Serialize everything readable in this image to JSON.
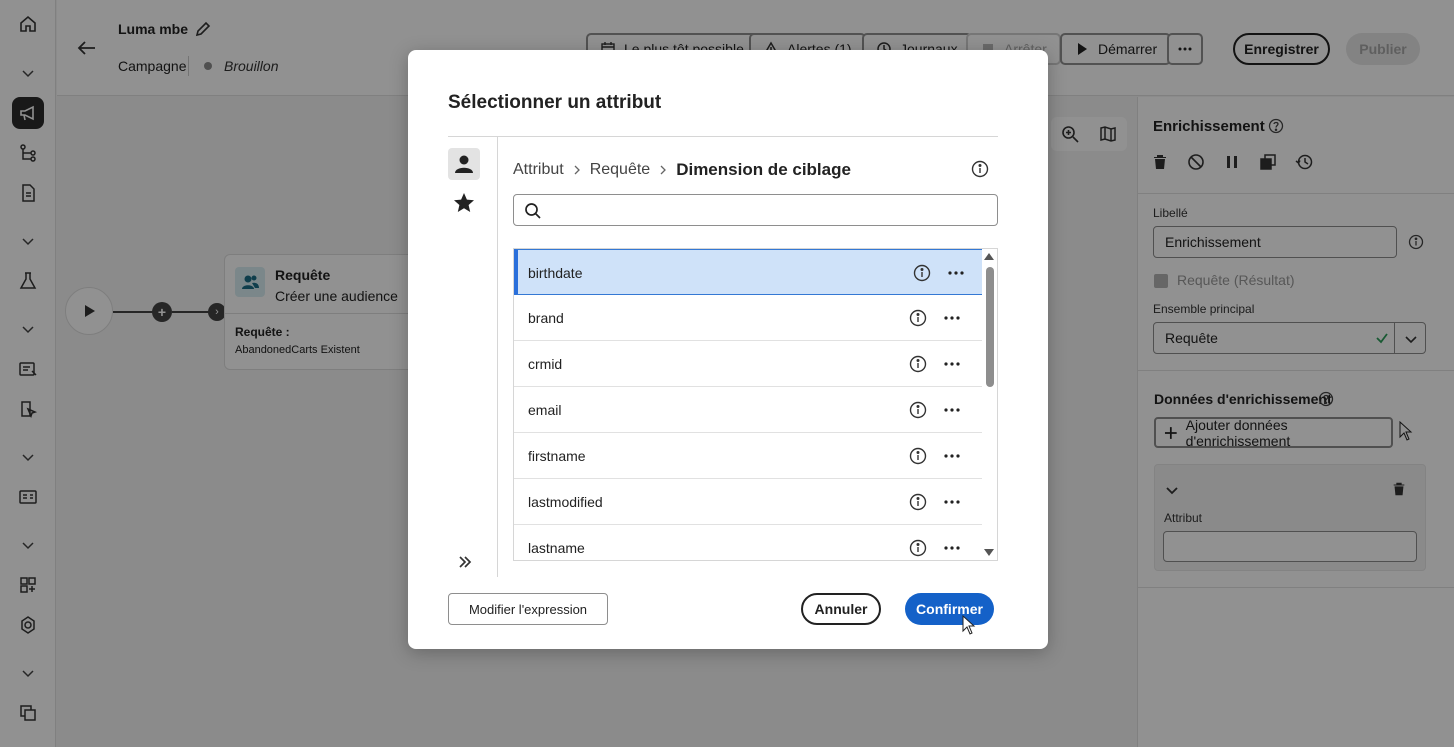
{
  "header": {
    "title": "Luma mbe",
    "breadcrumb": "Campagne",
    "status": "Brouillon",
    "buttons": {
      "schedule": "Le plus tôt possible",
      "alerts": "Alertes (1)",
      "logs": "Journaux",
      "stop": "Arrêter",
      "start": "Démarrer",
      "save": "Enregistrer",
      "publish": "Publier"
    }
  },
  "canvas": {
    "node": {
      "title": "Requête",
      "subtitle": "Créer une audience",
      "label": "Requête :",
      "value": "AbandonedCarts Existent"
    }
  },
  "panel": {
    "title": "Enrichissement",
    "label_field": "Libellé",
    "label_value": "Enrichissement",
    "query_result": "Requête (Résultat)",
    "main_set_label": "Ensemble principal",
    "main_set_value": "Requête",
    "enrich_section": "Données d'enrichissement",
    "add_button": "Ajouter données d'enrichissement",
    "attribute_label": "Attribut"
  },
  "modal": {
    "title": "Sélectionner un attribut",
    "breadcrumb": [
      "Attribut",
      "Requête",
      "Dimension de ciblage"
    ],
    "search_placeholder": "",
    "attributes": [
      "birthdate",
      "brand",
      "crmid",
      "email",
      "firstname",
      "lastmodified",
      "lastname"
    ],
    "selected_index": 0,
    "buttons": {
      "edit_expression": "Modifier l'expression",
      "cancel": "Annuler",
      "confirm": "Confirmer"
    }
  },
  "colors": {
    "accent": "#1461c8",
    "selected_row": "#cfe2f9",
    "overlay": "rgba(0,0,0,0.43)"
  }
}
